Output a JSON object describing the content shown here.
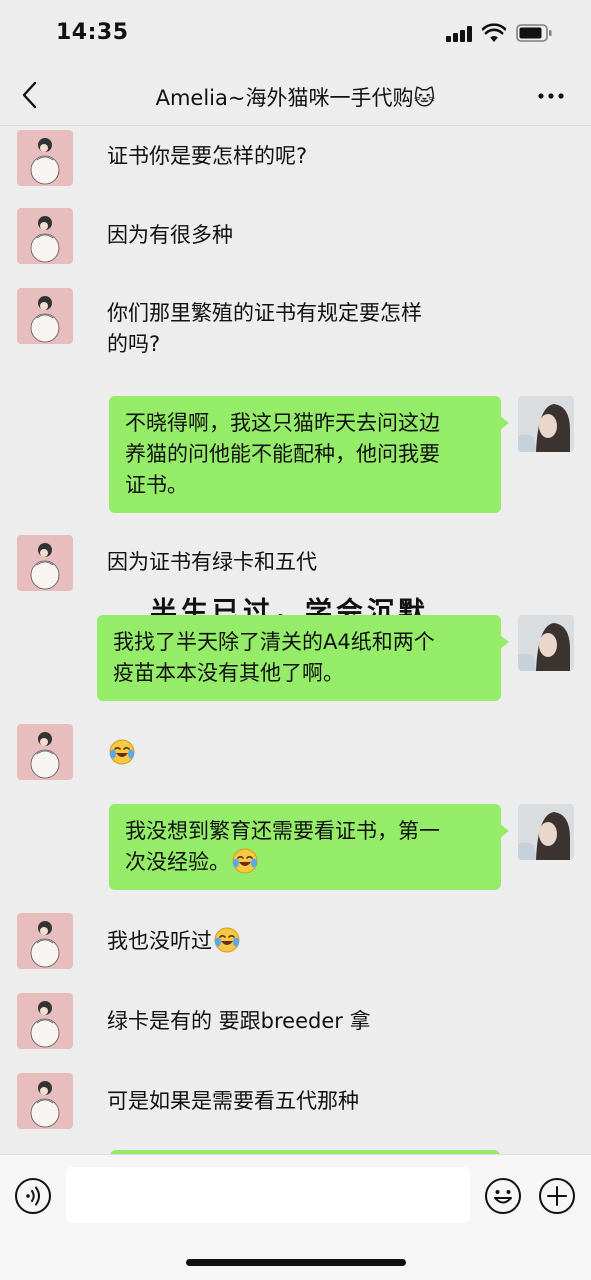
{
  "status_bar": {
    "time": "14:35"
  },
  "header": {
    "title": "Amelia~海外猫咪一手代购🐱"
  },
  "overlay_caption": "半生已过，学会沉默",
  "messages": [
    {
      "side": "left",
      "lines": [
        "证书你是要怎样的呢?"
      ]
    },
    {
      "side": "left",
      "lines": [
        "因为有很多种"
      ]
    },
    {
      "side": "left",
      "lines": [
        "你们那里繁殖的证书有规定要怎样",
        "的吗?"
      ]
    },
    {
      "side": "right",
      "lines": [
        "不晓得啊，我这只猫昨天去问这边",
        "养猫的问他能不能配种，他问我要",
        "证书。"
      ]
    },
    {
      "side": "left",
      "lines": [
        "因为证书有绿卡和五代"
      ]
    },
    {
      "side": "right",
      "lines": [
        "我找了半天除了清关的A4纸和两个",
        "疫苗本本没有其他了啊。"
      ]
    },
    {
      "side": "left",
      "lines": [
        ""
      ],
      "emoji": "face-with-tears-of-joy"
    },
    {
      "side": "right",
      "lines": [
        "我没想到繁育还需要看证书，第一",
        "次没经验。"
      ],
      "emoji": "face-with-tears-of-joy"
    },
    {
      "side": "left",
      "lines": [
        "我也没听过"
      ],
      "emoji": "face-with-tears-of-joy"
    },
    {
      "side": "left",
      "lines": [
        "绿卡是有的 要跟breeder 拿"
      ]
    },
    {
      "side": "left",
      "lines": [
        "可是如果是需要看五代那种"
      ]
    }
  ],
  "input_bar": {
    "placeholder": ""
  },
  "icons": {
    "back": "chevron-left-icon",
    "more": "more-dots-icon",
    "voice": "voice-icon",
    "emoji": "emoji-icon",
    "add": "plus-circle-icon"
  },
  "colors": {
    "outgoing_bubble": "#95ec69",
    "background": "#ededed"
  }
}
